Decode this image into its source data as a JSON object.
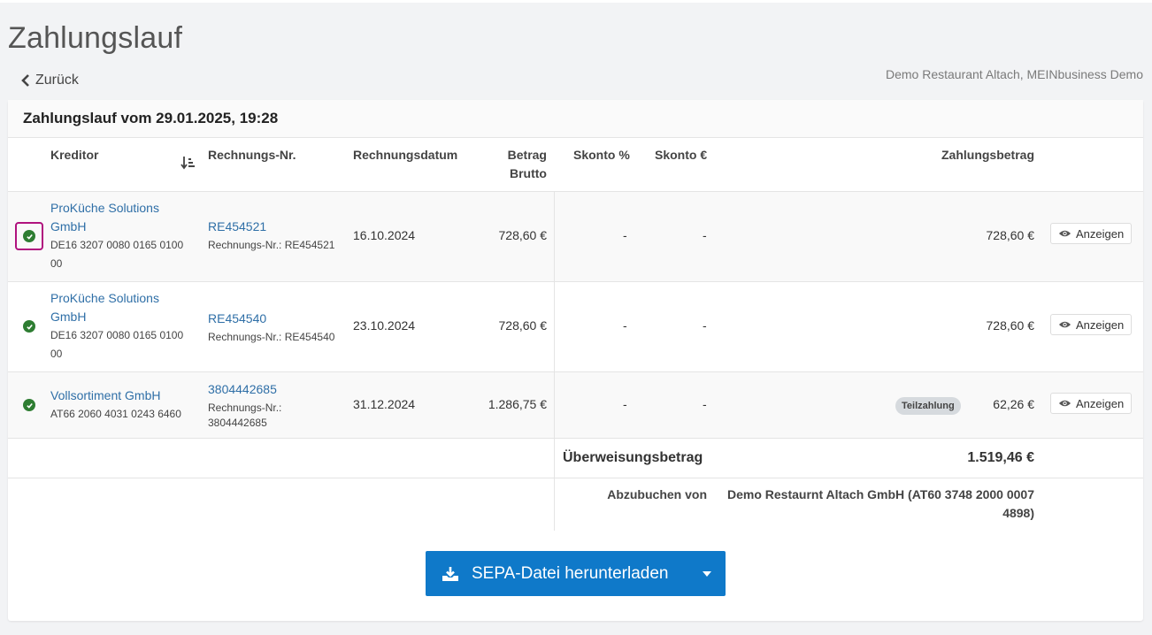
{
  "page": {
    "title": "Zahlungslauf",
    "back_label": "Zurück",
    "company": "Demo Restaurant Altach, MEINbusiness Demo"
  },
  "card": {
    "title": "Zahlungslauf vom 29.01.2025, 19:28"
  },
  "table": {
    "headers": {
      "kreditor": "Kreditor",
      "rechnungs_nr": "Rechnungs-Nr.",
      "rechnungsdatum": "Rechnungsdatum",
      "betrag_line1": "Betrag",
      "betrag_line2": "Brutto",
      "skonto_pct": "Skonto %",
      "skonto_eur": "Skonto €",
      "zahlungsbetrag": "Zahlungsbetrag"
    },
    "rows": [
      {
        "creditor_line1": "ProKüche Solutions",
        "creditor_line2": "GmbH",
        "iban_line1": "DE16 3207 0080 0165 0100",
        "iban_line2": "00",
        "invoice_no": "RE454521",
        "invoice_sub": "Rechnungs-Nr.: RE454521",
        "invoice_date": "16.10.2024",
        "gross": "728,60 €",
        "skonto_pct": "-",
        "skonto_eur": "-",
        "payment": "728,60 €",
        "view_label": "Anzeigen"
      },
      {
        "creditor_line1": "ProKüche Solutions",
        "creditor_line2": "GmbH",
        "iban_line1": "DE16 3207 0080 0165 0100",
        "iban_line2": "00",
        "invoice_no": "RE454540",
        "invoice_sub": "Rechnungs-Nr.: RE454540",
        "invoice_date": "23.10.2024",
        "gross": "728,60 €",
        "skonto_pct": "-",
        "skonto_eur": "-",
        "payment": "728,60 €",
        "view_label": "Anzeigen"
      },
      {
        "creditor_line1": "Vollsortiment GmbH",
        "iban_line1": "AT66 2060 4031 0243 6460",
        "invoice_no": "3804442685",
        "invoice_sub_line1": "Rechnungs-Nr.:",
        "invoice_sub_line2": "3804442685",
        "invoice_date": "31.12.2024",
        "gross": "1.286,75 €",
        "skonto_pct": "-",
        "skonto_eur": "-",
        "badge": "Teilzahlung",
        "payment": "62,26 €",
        "view_label": "Anzeigen"
      }
    ],
    "summary": {
      "transfer_label": "Überweisungsbetrag",
      "transfer_value": "1.519,46 €",
      "debit_label": "Abzubuchen von",
      "debit_value_line1": "Demo Restaurnt Altach GmbH (AT60 3748 2000 0007",
      "debit_value_line2": "4898)"
    }
  },
  "actions": {
    "sepa_label": "SEPA-Datei herunterladen"
  },
  "colors": {
    "primary": "#0f79c9",
    "link": "#2f6fa7",
    "check": "#2e7d32",
    "focus": "#b0127e"
  }
}
